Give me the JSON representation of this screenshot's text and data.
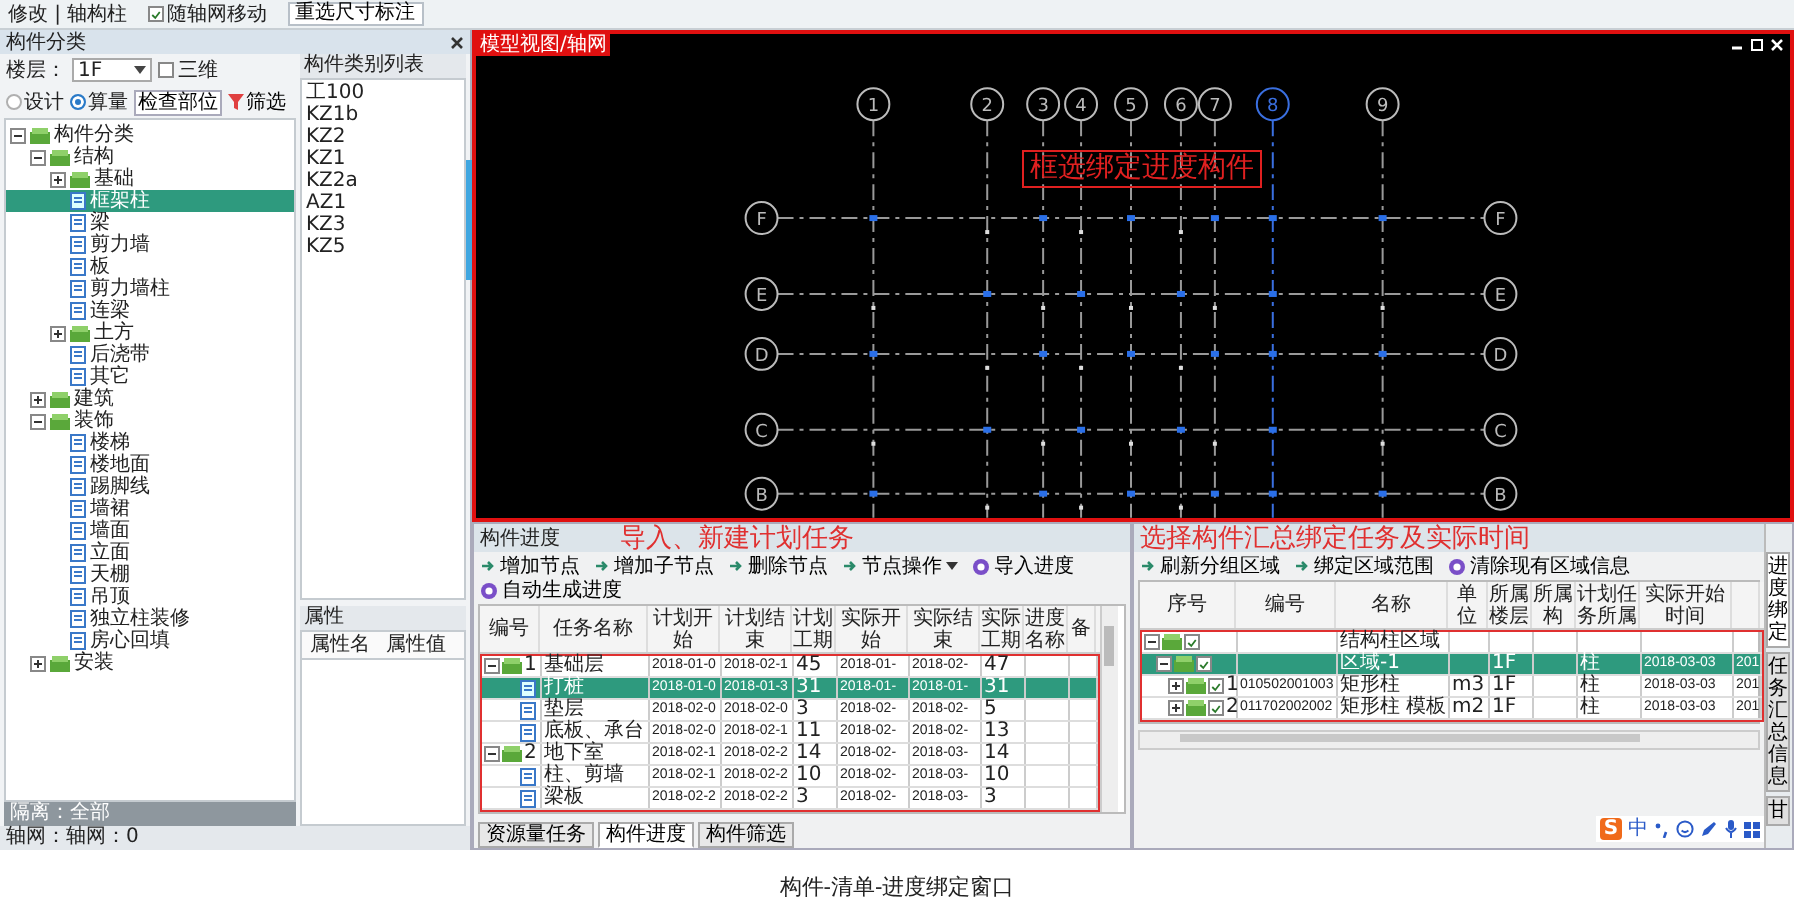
{
  "toolbar": {
    "items": [
      {
        "kind": "text",
        "label": "修改 | 轴构柱"
      },
      {
        "kind": "checkbox",
        "label": "随轴网移动",
        "checked": true
      },
      {
        "kind": "button",
        "label": "重选尺寸标注"
      }
    ]
  },
  "component_panel": {
    "title": "构件分类",
    "floor_label": "楼层：",
    "floor": "1F",
    "three_d": {
      "label": "三维",
      "checked": false
    },
    "modes": [
      {
        "label": "设计",
        "selected": false
      },
      {
        "label": "算量",
        "selected": true
      }
    ],
    "check_button": "检查部位",
    "filter_button": "筛选",
    "tree": [
      {
        "label": "构件分类",
        "kind": "folder",
        "expanded": true,
        "selected": false,
        "children": [
          {
            "label": "结构",
            "kind": "folder",
            "expanded": true,
            "selected": false,
            "children": [
              {
                "label": "基础",
                "kind": "folder",
                "expanded": false,
                "selected": false
              },
              {
                "label": "框架柱",
                "kind": "item",
                "selected": true
              },
              {
                "label": "梁",
                "kind": "item",
                "selected": false
              },
              {
                "label": "剪力墙",
                "kind": "item",
                "selected": false
              },
              {
                "label": "板",
                "kind": "item",
                "selected": false
              },
              {
                "label": "剪力墙柱",
                "kind": "item",
                "selected": false
              },
              {
                "label": "连梁",
                "kind": "item",
                "selected": false
              },
              {
                "label": "土方",
                "kind": "folder",
                "expanded": false,
                "selected": false
              },
              {
                "label": "后浇带",
                "kind": "item",
                "selected": false
              },
              {
                "label": "其它",
                "kind": "item",
                "selected": false
              }
            ]
          },
          {
            "label": "建筑",
            "kind": "folder",
            "expanded": false,
            "selected": false
          },
          {
            "label": "装饰",
            "kind": "folder",
            "expanded": true,
            "selected": false,
            "children": [
              {
                "label": "楼梯",
                "kind": "item",
                "selected": false
              },
              {
                "label": "楼地面",
                "kind": "item",
                "selected": false
              },
              {
                "label": "踢脚线",
                "kind": "item",
                "selected": false
              },
              {
                "label": "墙裙",
                "kind": "item",
                "selected": false
              },
              {
                "label": "墙面",
                "kind": "item",
                "selected": false
              },
              {
                "label": "立面",
                "kind": "item",
                "selected": false
              },
              {
                "label": "天棚",
                "kind": "item",
                "selected": false
              },
              {
                "label": "吊顶",
                "kind": "item",
                "selected": false
              },
              {
                "label": "独立柱装修",
                "kind": "item",
                "selected": false
              },
              {
                "label": "房心回填",
                "kind": "item",
                "selected": false
              }
            ]
          },
          {
            "label": "安装",
            "kind": "folder",
            "expanded": false,
            "selected": false
          }
        ]
      }
    ],
    "isolation": "隔离：全部"
  },
  "component_list": {
    "title": "构件类别列表",
    "items": [
      "工100",
      "KZ1b",
      "KZ2",
      "KZ1",
      "KZ2a",
      "AZ1",
      "KZ3",
      "KZ5"
    ]
  },
  "properties": {
    "title": "属性",
    "columns": [
      "属性名",
      "属性值"
    ]
  },
  "status_bar": "轴网：轴网：0",
  "viewport": {
    "title": "模型视图/轴网",
    "annotation": "框选绑定进度构件",
    "column_axes": [
      {
        "label": "1",
        "highlighted": false
      },
      {
        "label": "2",
        "highlighted": false
      },
      {
        "label": "3",
        "highlighted": false
      },
      {
        "label": "4",
        "highlighted": false
      },
      {
        "label": "5",
        "highlighted": false
      },
      {
        "label": "6",
        "highlighted": false
      },
      {
        "label": "7",
        "highlighted": false
      },
      {
        "label": "8",
        "highlighted": true
      },
      {
        "label": "9",
        "highlighted": false
      }
    ],
    "row_axes": [
      {
        "left": "F",
        "right": "F"
      },
      {
        "left": "E",
        "right": "E"
      },
      {
        "left": "D",
        "right": "D"
      },
      {
        "left": "C",
        "right": "C"
      },
      {
        "left": "B",
        "right": "B"
      }
    ]
  },
  "progress_panel": {
    "title": "构件进度",
    "annotation": "导入、新建计划任务",
    "tools": [
      {
        "label": "增加节点",
        "kind": "arrow",
        "menu": false
      },
      {
        "label": "增加子节点",
        "kind": "arrow",
        "menu": false
      },
      {
        "label": "删除节点",
        "kind": "arrow",
        "menu": false
      },
      {
        "label": "节点操作",
        "kind": "arrow",
        "menu": true
      },
      {
        "label": "导入进度",
        "kind": "circle",
        "menu": false
      },
      {
        "label": "自动生成进度",
        "kind": "circle",
        "menu": false
      }
    ],
    "columns": [
      "编号",
      "任务名称",
      "计划开始",
      "计划结束",
      "计划工期",
      "实际开始",
      "实际结束",
      "实际工期",
      "进度名称",
      "备"
    ],
    "tasks": [
      {
        "cells": [
          "1",
          "基础层",
          "2018-01-0",
          "2018-02-1",
          "45",
          "2018-01-",
          "2018-02-",
          "47",
          null,
          null
        ],
        "expanded": true,
        "selected": false,
        "children": [
          {
            "cells": [
              null,
              "打桩",
              "2018-01-0",
              "2018-01-3",
              "31",
              "2018-01-",
              "2018-01-",
              "31",
              null,
              null
            ],
            "selected": true
          },
          {
            "cells": [
              null,
              "垫层",
              "2018-02-0",
              "2018-02-0",
              "3",
              "2018-02-",
              "2018-02-",
              "5",
              null,
              null
            ],
            "selected": false
          },
          {
            "cells": [
              null,
              "底板、承台",
              "2018-02-0",
              "2018-02-1",
              "11",
              "2018-02-",
              "2018-02-",
              "13",
              null,
              null
            ],
            "selected": false
          }
        ]
      },
      {
        "cells": [
          "2",
          "地下室",
          "2018-02-1",
          "2018-02-2",
          "14",
          "2018-02-",
          "2018-03-",
          "14",
          null,
          null
        ],
        "expanded": true,
        "selected": false,
        "children": [
          {
            "cells": [
              null,
              "柱、剪墙",
              "2018-02-1",
              "2018-02-2",
              "10",
              "2018-02-",
              "2018-03-",
              "10",
              null,
              null
            ],
            "selected": false
          },
          {
            "cells": [
              null,
              "梁板",
              "2018-02-2",
              "2018-02-2",
              "3",
              "2018-02-",
              "2018-03-",
              "3",
              null,
              null
            ],
            "selected": false
          }
        ]
      }
    ],
    "tabs": [
      {
        "label": "资源量任务",
        "selected": false
      },
      {
        "label": "构件进度",
        "selected": true
      },
      {
        "label": "构件筛选",
        "selected": false
      }
    ]
  },
  "binding_panel": {
    "annotation": "选择构件汇总绑定任务及实际时间",
    "tools": [
      {
        "label": "刷新分组区域",
        "kind": "arrow",
        "menu": false
      },
      {
        "label": "绑定区域范围",
        "kind": "arrow",
        "menu": false
      },
      {
        "label": "清除现有区域信息",
        "kind": "circle",
        "menu": false
      }
    ],
    "columns": [
      "序号",
      "编号",
      "名称",
      "单位",
      "所属楼层",
      "所属构",
      "计划任务所属",
      "实际开始时间"
    ],
    "rows": [
      {
        "cells": [
          null,
          null,
          "结构柱区域",
          null,
          null,
          null,
          null,
          null,
          null
        ],
        "checked": true,
        "expanded": true,
        "selected": false,
        "children": [
          {
            "cells": [
              null,
              null,
              "区域-1",
              null,
              "1F",
              null,
              "柱",
              "2018-03-03",
              "201"
            ],
            "checked": true,
            "expanded": true,
            "selected": true,
            "children": [
              {
                "cells": [
                  "1",
                  "010502001003",
                  "矩形柱",
                  "m3",
                  "1F",
                  null,
                  "柱",
                  "2018-03-03",
                  "201"
                ],
                "checked": true,
                "expanded": false,
                "selected": false
              },
              {
                "cells": [
                  "2",
                  "011702002002",
                  "矩形柱 模板",
                  "m2",
                  "1F",
                  null,
                  "柱",
                  "2018-03-03",
                  "201"
                ],
                "checked": true,
                "expanded": false,
                "selected": false
              }
            ]
          }
        ]
      }
    ],
    "side_tabs": [
      {
        "label": "进度绑定",
        "selected": true
      },
      {
        "label": "任务汇总信息",
        "selected": false
      },
      {
        "label": "甘",
        "selected": false
      }
    ]
  },
  "ime_bar": {
    "logo": "S",
    "mode": "中"
  },
  "caption": "构件-清单-进度绑定窗口"
}
